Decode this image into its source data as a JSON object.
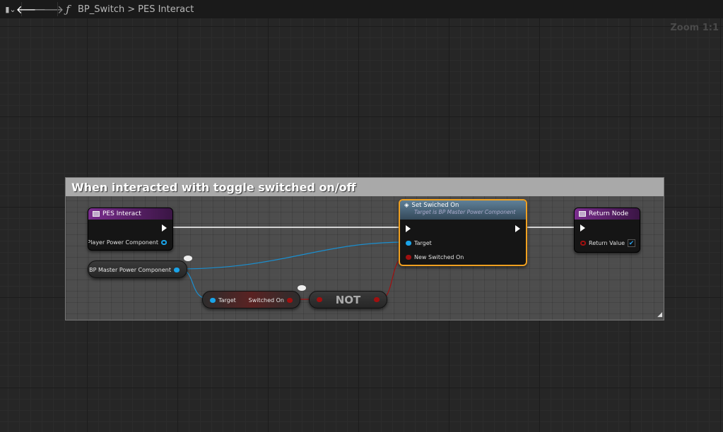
{
  "toolbar": {
    "bookmark_icon": "bookmark-icon",
    "function_icon": "ƒ",
    "blueprint": "BP_Switch",
    "separator": ">",
    "function": "PES Interact"
  },
  "zoom_label": "Zoom 1:1",
  "comment": {
    "title": "When interacted with toggle switched on/off"
  },
  "nodes": {
    "pes_interact": {
      "title": "PES Interact",
      "pin": "Player Power Component"
    },
    "bp_master": {
      "label": "BP Master Power Component"
    },
    "get_switched": {
      "target": "Target",
      "output": "Switched On"
    },
    "not": {
      "label": "NOT"
    },
    "set_switched": {
      "title": "Set Swiched On",
      "subtitle": "Target is BP Master Power Component",
      "target": "Target",
      "input": "New Switched On"
    },
    "return": {
      "title": "Return Node",
      "pin": "Return Value",
      "checked": true
    }
  },
  "colors": {
    "object": "#1aa3e8",
    "bool": "#9a0f0f",
    "exec": "#ffffff",
    "selected": "#f0a020"
  }
}
